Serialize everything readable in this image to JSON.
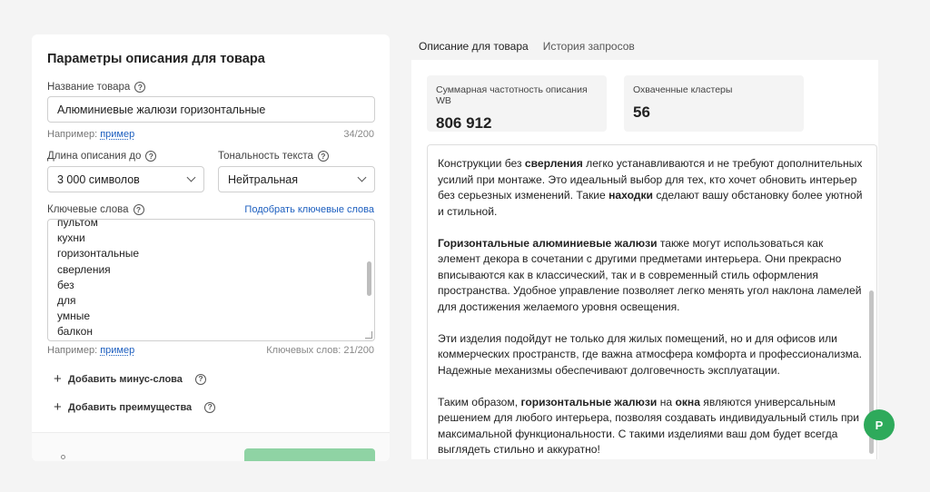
{
  "form": {
    "title": "Параметры описания для товара",
    "product_name": {
      "label": "Название товара",
      "value": "Алюминиевые жалюзи горизонтальные",
      "hint_prefix": "Например:",
      "hint_link": "пример",
      "counter": "34/200"
    },
    "length": {
      "label": "Длина описания до",
      "value": "3 000 символов"
    },
    "tone": {
      "label": "Тональность текста",
      "value": "Нейтральная"
    },
    "keywords": {
      "label": "Ключевые слова",
      "pick_link": "Подобрать ключевые слова",
      "items": [
        "пультом",
        "кухни",
        "горизонтальные",
        "сверления",
        "без",
        "для",
        "умные",
        "балкон"
      ],
      "hint_prefix": "Например:",
      "hint_link": "пример",
      "counter": "Ключевых слов: 21/200"
    },
    "add_minus_words": "Добавить минус-слова",
    "add_advantages": "Добавить преимущества"
  },
  "tabs": [
    {
      "label": "Описание для товара",
      "active": true
    },
    {
      "label": "История запросов",
      "active": false
    }
  ],
  "stats": {
    "frequency": {
      "label": "Суммарная частотность описания WB",
      "value": "806 912"
    },
    "clusters": {
      "label": "Охваченные кластеры",
      "value": "56"
    }
  },
  "description": {
    "p1": {
      "a": "Конструкции без ",
      "b": "сверления",
      "c": " легко устанавливаются и не требуют дополнительных усилий при монтаже. Это идеальный выбор для тех, кто хочет обновить интерьер без серьезных изменений. Такие ",
      "d": "находки",
      "e": " сделают вашу обстановку более уютной и стильной."
    },
    "p2": {
      "a": "Горизонтальные алюминиевые жалюзи",
      "b": " также могут использоваться как элемент декора в сочетании с другими предметами интерьера. Они прекрасно вписываются как в классический, так и в современный стиль оформления пространства. Удобное управление позволяет легко менять угол наклона ламелей для достижения желаемого уровня освещения."
    },
    "p3": "Эти изделия подойдут не только для жилых помещений, но и для офисов или коммерческих пространств, где важна атмосфера комфорта и профессионализма. Надежные механизмы обеспечивают долговечность эксплуатации.",
    "p4": {
      "a": "Таким образом, ",
      "b": "горизонтальные жалюзи",
      "c": " на ",
      "d": "окна",
      "e": " являются универсальным решением для любого интерьера, позволяя создавать индивидуальный стиль при максимальной функциональности. С такими изделиями ваш дом будет всегда выглядеть стильно и аккуратно!"
    }
  },
  "fab_label": "Р",
  "colors": {
    "accent": "#2eaa5b",
    "link": "#1d5fbf",
    "button_disabled": "#8fd3a4"
  }
}
